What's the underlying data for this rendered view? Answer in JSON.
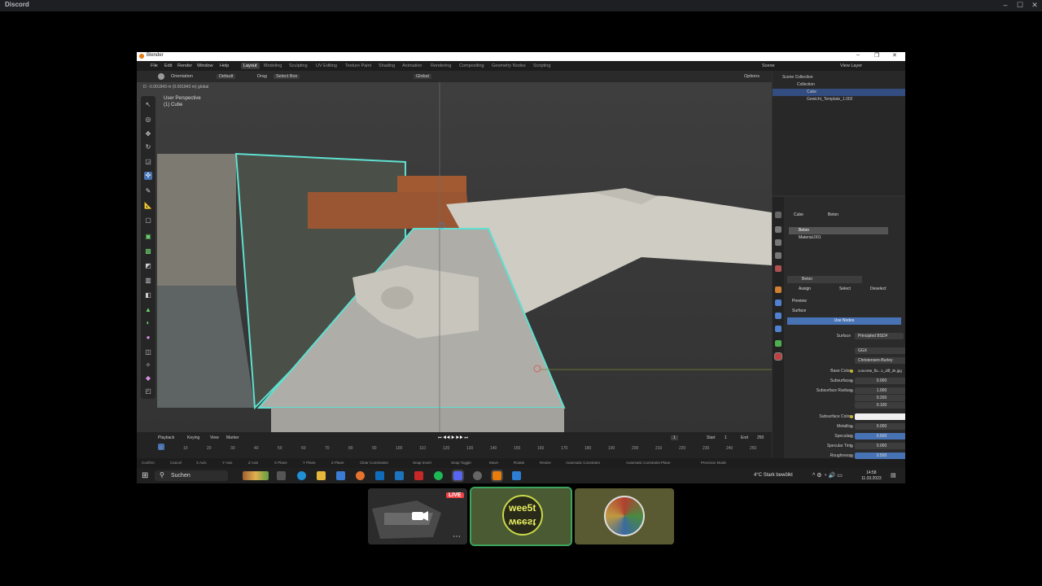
{
  "discord": {
    "title": "Discord",
    "window_controls": [
      "–",
      "☐",
      "✕"
    ]
  },
  "blender": {
    "window_title": "Blender",
    "menus": [
      "File",
      "Edit",
      "Render",
      "Window",
      "Help"
    ],
    "workspaces": [
      "Layout",
      "Modeling",
      "Sculpting",
      "UV Editing",
      "Texture Paint",
      "Shading",
      "Animation",
      "Rendering",
      "Compositing",
      "Geometry Nodes",
      "Scripting"
    ],
    "active_workspace": "Layout",
    "scene": "Scene",
    "view_layer": "View Layer",
    "header": {
      "orientation_label": "Orientation",
      "orientation_value": "Default",
      "drag_label": "Drag",
      "drag_value": "Select Box",
      "transform": "Global",
      "options": "Options"
    },
    "status_info": "D: -0.001843 m (0.001843 m) global",
    "viewport": {
      "label1": "User Perspective",
      "label2": "(1) Cube"
    },
    "timeline": {
      "menus": [
        "Playback",
        "Keying",
        "View",
        "Marker"
      ],
      "current_frame": "1",
      "start_label": "Start",
      "start": "1",
      "end_label": "End",
      "end": "250",
      "ticks": [
        "0",
        "10",
        "20",
        "30",
        "40",
        "50",
        "60",
        "70",
        "80",
        "90",
        "100",
        "110",
        "120",
        "130",
        "140",
        "150",
        "160",
        "170",
        "180",
        "190",
        "200",
        "210",
        "220",
        "230",
        "240",
        "250"
      ]
    },
    "statusbar": [
      "Confirm",
      "Cancel",
      "X Axis",
      "Y Axis",
      "Z Axis",
      "X Plane",
      "Y Plane",
      "Z Plane",
      "Clear Constraints",
      "Snap Invert",
      "Snap Toggle",
      "Move",
      "Rotate",
      "Resize",
      "Automatic Constraint",
      "Automatic Constraint Plane",
      "Precision Mode"
    ],
    "outliner": {
      "rows": [
        "Scene Collection",
        "Collection",
        "Cube",
        "Gewicht_Template_1.002"
      ]
    },
    "properties": {
      "object": "Cube",
      "material_name": "Beton",
      "slots": [
        "Beton",
        "Material.001"
      ],
      "buttons": [
        "Assign",
        "Select",
        "Deselect"
      ],
      "sections": [
        "Preview",
        "Surface"
      ],
      "use_nodes": "Use Nodes",
      "surface_label": "Surface",
      "surface_value": "Principled BSDF",
      "distribution": "GGX",
      "subsurface_method": "Christensen-Burley",
      "fields": [
        {
          "label": "Base Color",
          "value": "concrete_flo...1_diff_2k.jpg"
        },
        {
          "label": "Subsurface",
          "value": "0.000"
        },
        {
          "label": "Subsurface Radius",
          "value": "1.000"
        },
        {
          "label": "",
          "value": "0.200"
        },
        {
          "label": "",
          "value": "0.100"
        },
        {
          "label": "Subsurface Color",
          "value": ""
        },
        {
          "label": "Metallic",
          "value": "0.000"
        },
        {
          "label": "Specular",
          "value": "0.500"
        },
        {
          "label": "Specular Tint",
          "value": "0.000"
        },
        {
          "label": "Roughness",
          "value": "0.500"
        }
      ]
    }
  },
  "taskbar": {
    "search": "Suchen",
    "weather": "4°C  Stark bewölkt",
    "time": "14:58",
    "date": "11.03.2023"
  },
  "discord_call": {
    "live": "LIVE",
    "tile2_text": "wee5t"
  },
  "colors": {
    "accent_blue": "#4772b3",
    "selection_cyan": "#5fe0d0",
    "live_red": "#ed4245"
  }
}
